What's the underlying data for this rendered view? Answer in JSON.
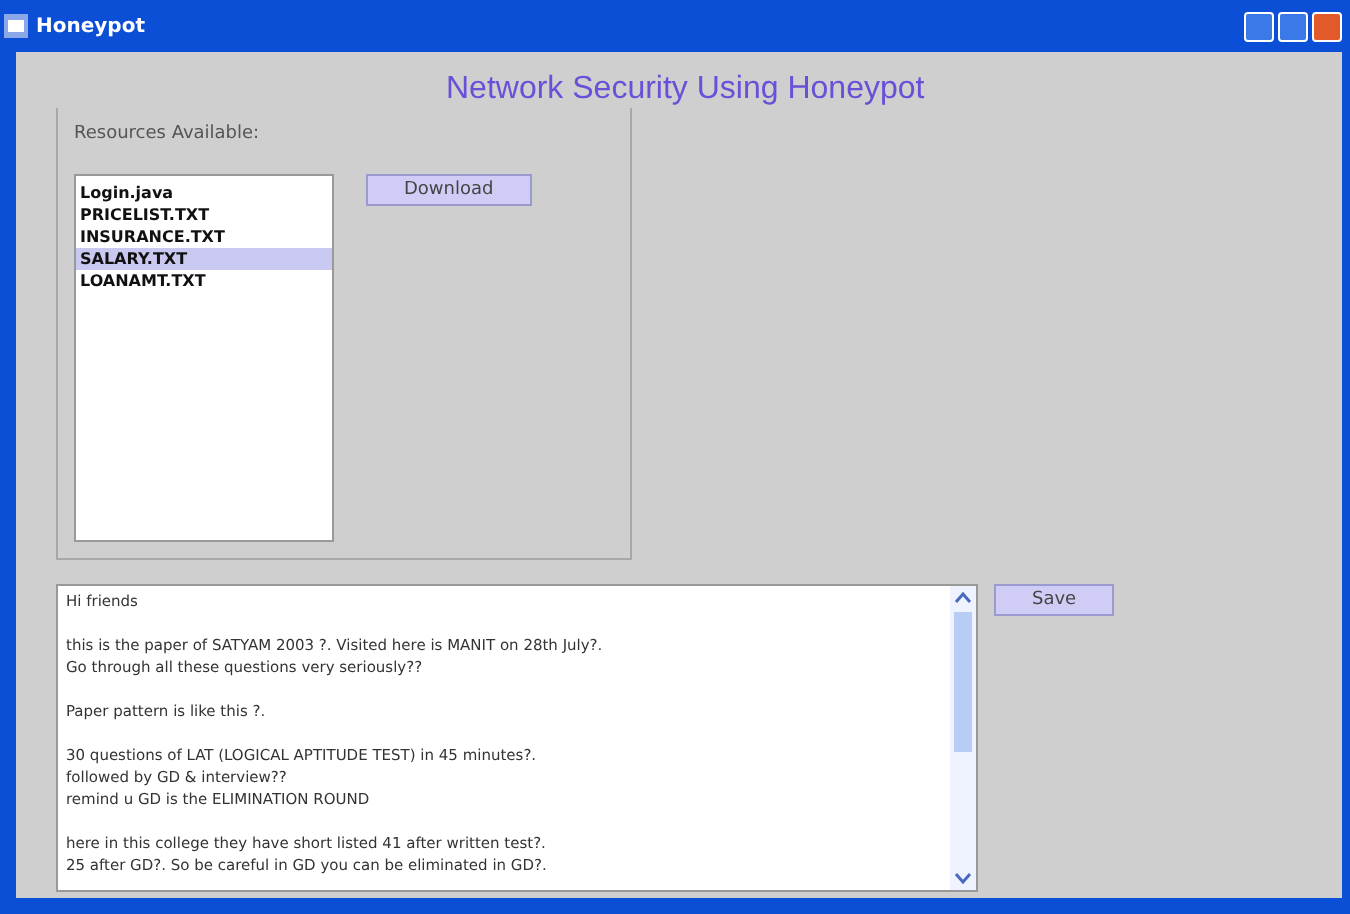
{
  "window": {
    "title": "Honeypot"
  },
  "heading": "Network Security Using Honeypot",
  "resources": {
    "label": "Resources Available:",
    "items": [
      {
        "label": "Login.java",
        "selected": false
      },
      {
        "label": "PRICELIST.TXT",
        "selected": false
      },
      {
        "label": "INSURANCE.TXT",
        "selected": false
      },
      {
        "label": "SALARY.TXT",
        "selected": true
      },
      {
        "label": "LOANAMT.TXT",
        "selected": false
      }
    ],
    "button": "Download"
  },
  "document": {
    "paragraphs": [
      [
        "Hi friends"
      ],
      [
        "this is the paper of SATYAM 2003 ?.  Visited here is MANIT on 28th July?.",
        "Go through all these questions very seriously??"
      ],
      [
        "Paper pattern is like this ?."
      ],
      [
        "30 questions of LAT (LOGICAL APTITUDE TEST) in 45 minutes?.",
        "followed by GD & interview??",
        "remind u GD is the  ELIMINATION ROUND"
      ],
      [
        "here in this college they have short listed 41 after written test?.",
        "25 after GD?. So be careful in GD you can be eliminated in GD?."
      ]
    ],
    "button": "Save"
  }
}
